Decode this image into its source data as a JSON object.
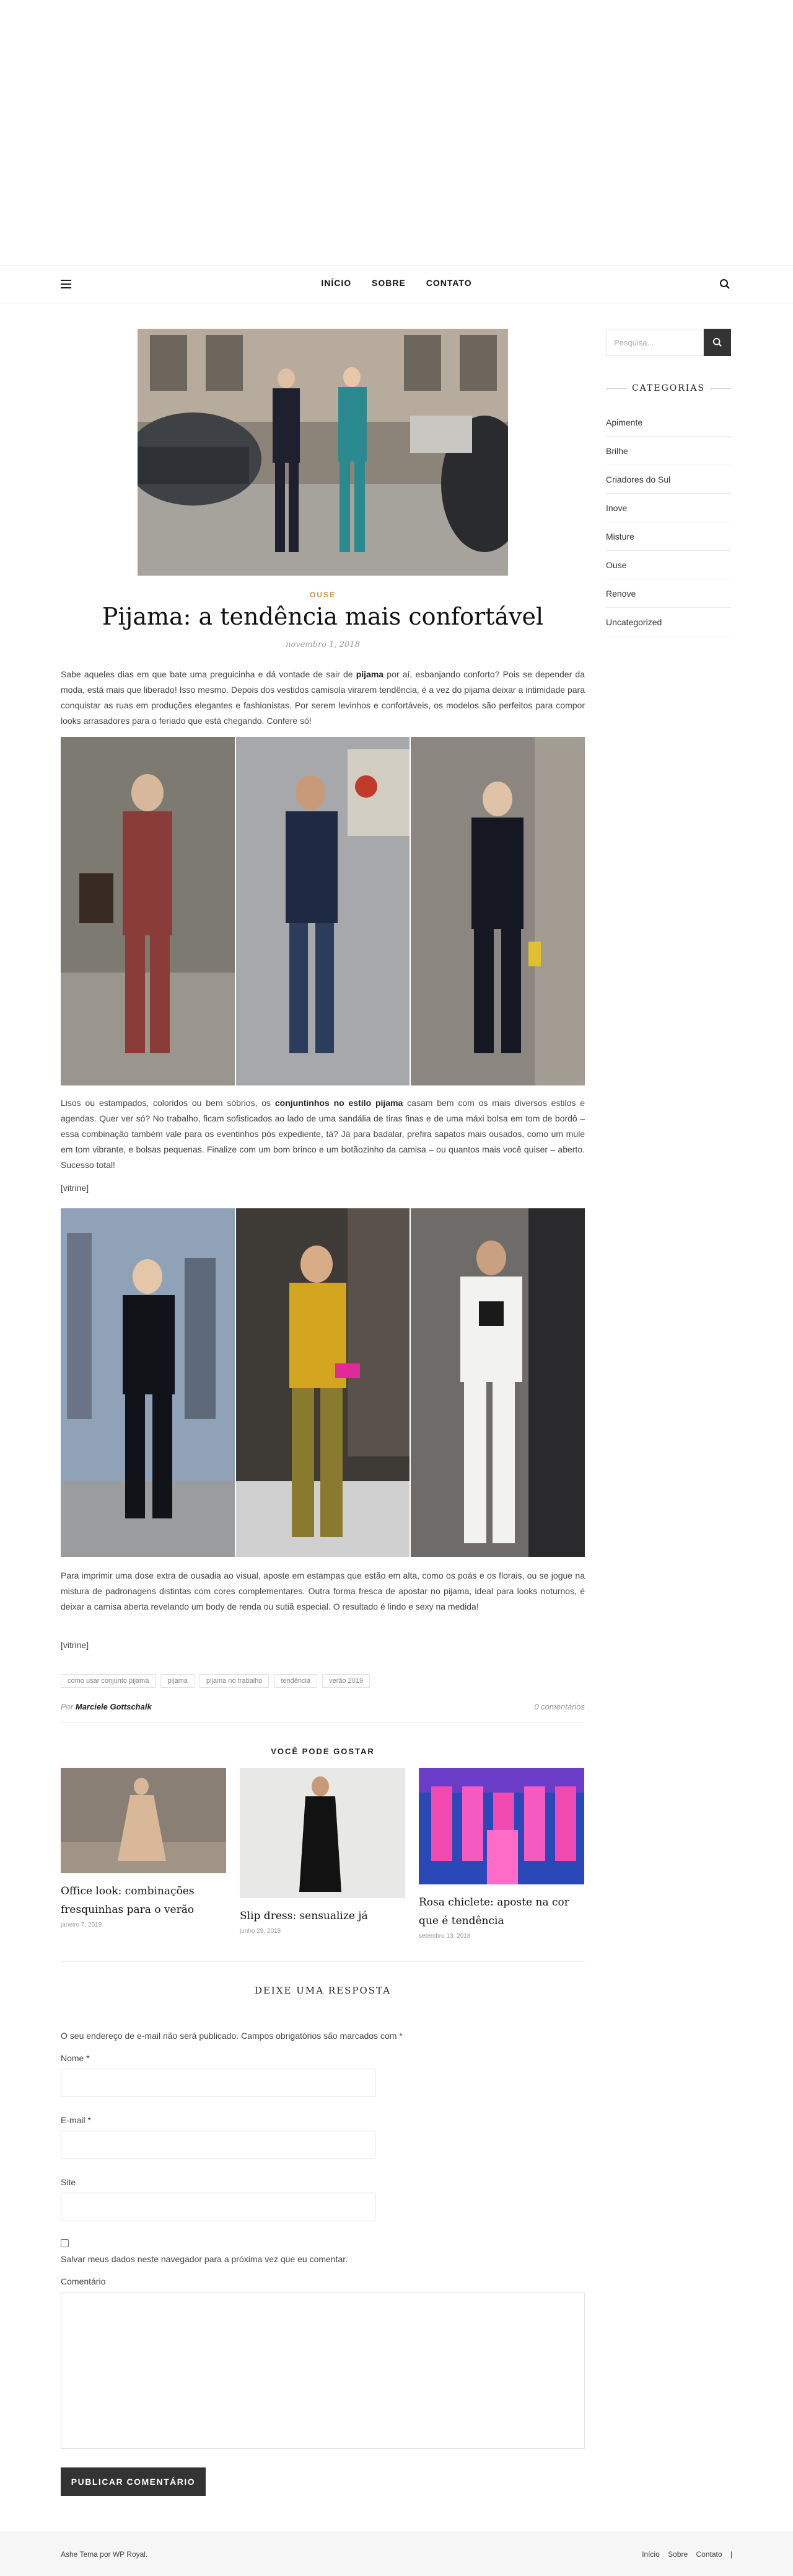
{
  "nav": {
    "links": [
      "INÍCIO",
      "SOBRE",
      "CONTATO"
    ]
  },
  "post": {
    "category": "OUSE",
    "title": "Pijama: a tendência mais confortável",
    "date": "novembro 1, 2018",
    "intro": {
      "before": "Sabe aqueles dias em que bate uma preguicinha e dá vontade de sair de ",
      "bold": "pijama",
      "after": " por aí, esbanjando conforto? Pois se depender da moda, está mais que liberado! Isso mesmo. Depois dos vestidos camisola virarem tendência, é a vez do pijama deixar a intimidade para conquistar as ruas em produções elegantes e fashionistas. Por serem levinhos e confortáveis, os modelos são perfeitos para compor looks arrasadores para o feriado que está chegando. Confere só!"
    },
    "para2": {
      "before": "Lisos ou estampados, coloridos ou bem sóbrios, os ",
      "bold": "conjuntinhos no estilo pijama",
      "after": "  casam bem com os mais diversos estilos e agendas. Quer ver só? No trabalho, ficam sofisticados ao lado de uma sandália de tiras finas e de uma máxi bolsa em tom de bordô – essa combinação também vale para os eventinhos pós expediente, tá? Já para badalar, prefira sapatos mais ousados, como um mule em tom vibrante, e bolsas pequenas. Finalize com um bom brinco e um botãozinho da camisa – ou quantos mais você quiser – aberto. Sucesso total!"
    },
    "vitrine": "[vitrine]",
    "para3": "Para imprimir uma dose extra de ousadia ao visual, aposte em estampas que estão em alta, como os poás e os florais, ou se jogue na mistura de padronagens distintas com cores complementares. Outra forma fresca de apostar no pijama, ideal para looks noturnos, é deixar a camisa aberta revelando um body de renda ou sutiã especial. O resultado é lindo e sexy na medida!",
    "tags": [
      "como usar conjunto pijama",
      "pijama",
      "pijama no trabalho",
      "tendência",
      "verão 2019"
    ],
    "by": "Por",
    "author": "Marciele Gottschalk",
    "comments": "0 comentários"
  },
  "related": {
    "heading": "VOCÊ PODE GOSTAR",
    "items": [
      {
        "title": "Office look: combinações fresquinhas para o verão",
        "date": "janeiro 7, 2019"
      },
      {
        "title": "Slip dress: sensualize já",
        "date": "junho 29, 2018"
      },
      {
        "title": "Rosa chiclete: aposte na cor que é tendência",
        "date": "setembro 13, 2018"
      }
    ]
  },
  "comment_form": {
    "heading": "DEIXE UMA RESPOSTA",
    "notice": "O seu endereço de e-mail não será publicado. Campos obrigatórios são marcados com *",
    "name_label": "Nome *",
    "email_label": "E-mail *",
    "site_label": "Site",
    "save_label": "Salvar meus dados neste navegador para a próxima vez que eu comentar.",
    "comment_label": "Comentário",
    "submit_label": "PUBLICAR COMENTÁRIO"
  },
  "sidebar": {
    "search_placeholder": "Pesquisa...",
    "categories_title": "CATEGORIAS",
    "categories": [
      "Apimente",
      "Brilhe",
      "Criadores do Sul",
      "Inove",
      "Misture",
      "Ouse",
      "Renove",
      "Uncategorized"
    ]
  },
  "footer": {
    "credit": "Ashe Tema por WP Royal.",
    "links": [
      "Início",
      "Sobre",
      "Contato",
      "|"
    ]
  },
  "colors": {
    "accent": "#ca9b52",
    "dark": "#333333",
    "footer_bg": "#f6f6f6"
  }
}
